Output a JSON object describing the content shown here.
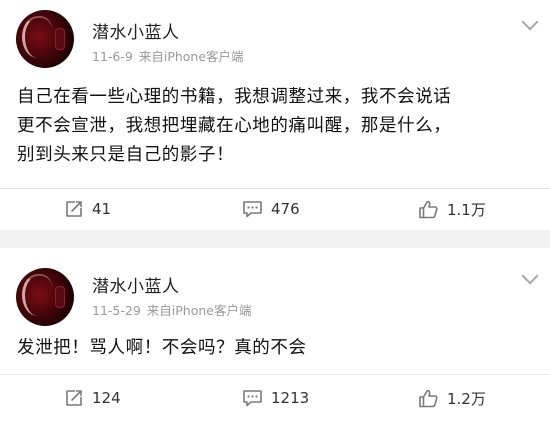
{
  "posts": [
    {
      "username": "潜水小蓝人",
      "date": "11-6-9",
      "source": "来自iPhone客户端",
      "text_lines": [
        "自己在看一些心理的书籍，我想调整过来，我不会说话",
        "更不会宣泄，我想把埋藏在心地的痛叫醒，那是什么，",
        "别到头来只是自己的影子！"
      ],
      "reposts": "41",
      "comments": "476",
      "likes": "1.1万"
    },
    {
      "username": "潜水小蓝人",
      "date": "11-5-29",
      "source": "来自iPhone客户端",
      "text_lines": [
        "发泄把！骂人啊！不会吗？真的不会"
      ],
      "reposts": "124",
      "comments": "1213",
      "likes": "1.2万"
    }
  ],
  "icons": {
    "repost": "repost-icon",
    "comment": "comment-icon",
    "like": "thumbs-up-icon",
    "menu": "chevron-down-icon"
  },
  "colors": {
    "background": "#f2f2f2",
    "card": "#ffffff",
    "text": "#111111",
    "meta": "#999999",
    "icon": "#7a7a7a"
  }
}
